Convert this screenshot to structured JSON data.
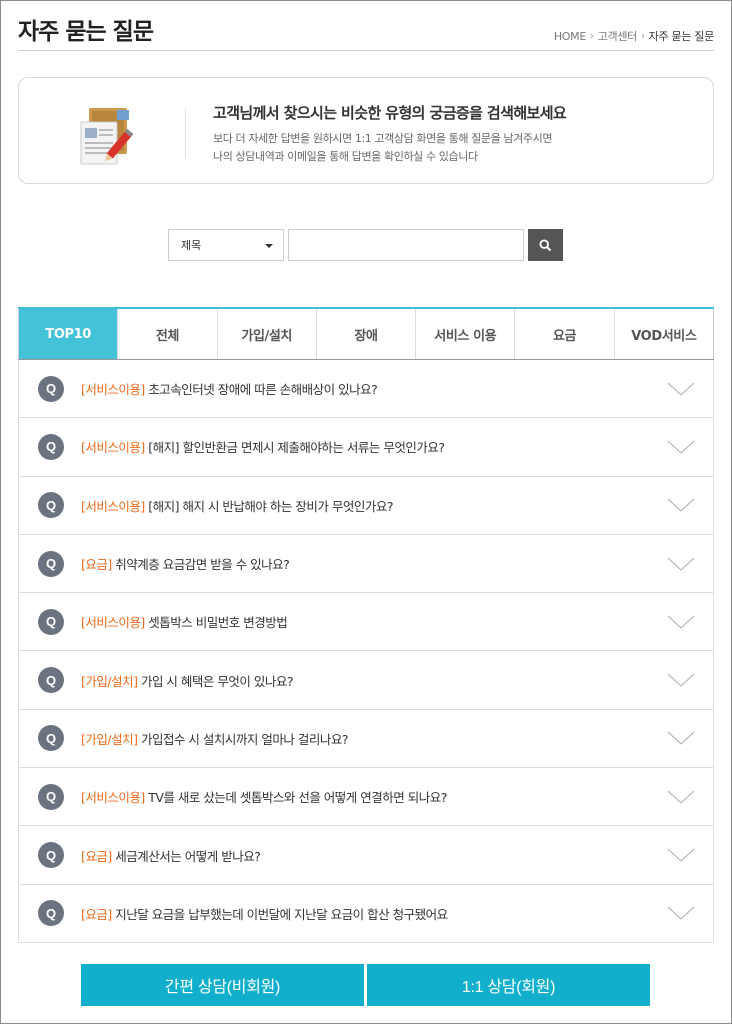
{
  "header": {
    "title": "자주 묻는 질문",
    "breadcrumb": [
      "HOME",
      "고객센터",
      "자주 묻는 질문"
    ]
  },
  "info": {
    "title": "고객님께서 찾으시는 비슷한 유형의 궁금증을 검색해보세요",
    "desc_line1": "보다 더 자세한 답변을 원하시면 1:1 고객상담 화면을 통해 질문을 남겨주시면",
    "desc_line2": "나의 상담내역과 이메일을 통해 답변을 확인하실 수 있습니다"
  },
  "search": {
    "select_value": "제목",
    "input_value": ""
  },
  "tabs": [
    {
      "label": "TOP10",
      "active": true
    },
    {
      "label": "전체"
    },
    {
      "label": "가입/설치"
    },
    {
      "label": "장애"
    },
    {
      "label": "서비스 이용"
    },
    {
      "label": "요금"
    },
    {
      "label": "VOD서비스"
    }
  ],
  "faq": {
    "badge": "Q",
    "items": [
      {
        "category": "[서비스이용]",
        "question": "초고속인터넷 장애에 따른 손해배상이 있나요?"
      },
      {
        "category": "[서비스이용]",
        "question": "[해지] 할인반환금 면제시 제출해야하는 서류는 무엇인가요?"
      },
      {
        "category": "[서비스이용]",
        "question": "[해지] 해지 시 반납해야 하는 장비가 무엇인가요?"
      },
      {
        "category": "[요금]",
        "question": "취약계층 요금감면 받을 수 있나요?"
      },
      {
        "category": "[서비스이용]",
        "question": "셋톱박스 비밀번호 변경방법"
      },
      {
        "category": "[가입/설치]",
        "question": "가입 시 혜택은 무엇이 있나요?"
      },
      {
        "category": "[가입/설치]",
        "question": "가입접수 시 설치시까지 얼마나 걸리나요?"
      },
      {
        "category": "[서비스이용]",
        "question": "TV를 새로 샀는데 셋톱박스와 선을 어떻게 연결하면 되나요?"
      },
      {
        "category": "[요금]",
        "question": "세금계산서는 어떻게 받나요?"
      },
      {
        "category": "[요금]",
        "question": "지난달 요금을 납부했는데 이번달에 지난달 요금이 합산 청구됐어요"
      }
    ]
  },
  "buttons": {
    "guest": "간편 상담(비회원)",
    "member": "1:1 상담(회원)"
  },
  "colors": {
    "accent": "#44c2d8",
    "button": "#11afcb",
    "category": "#f06a1b",
    "badge": "#6c7380"
  },
  "icons": {
    "info": "document-pencil-icon",
    "search": "search-icon",
    "faq_badge": "q-icon",
    "toggle": "chevron-down-icon"
  }
}
